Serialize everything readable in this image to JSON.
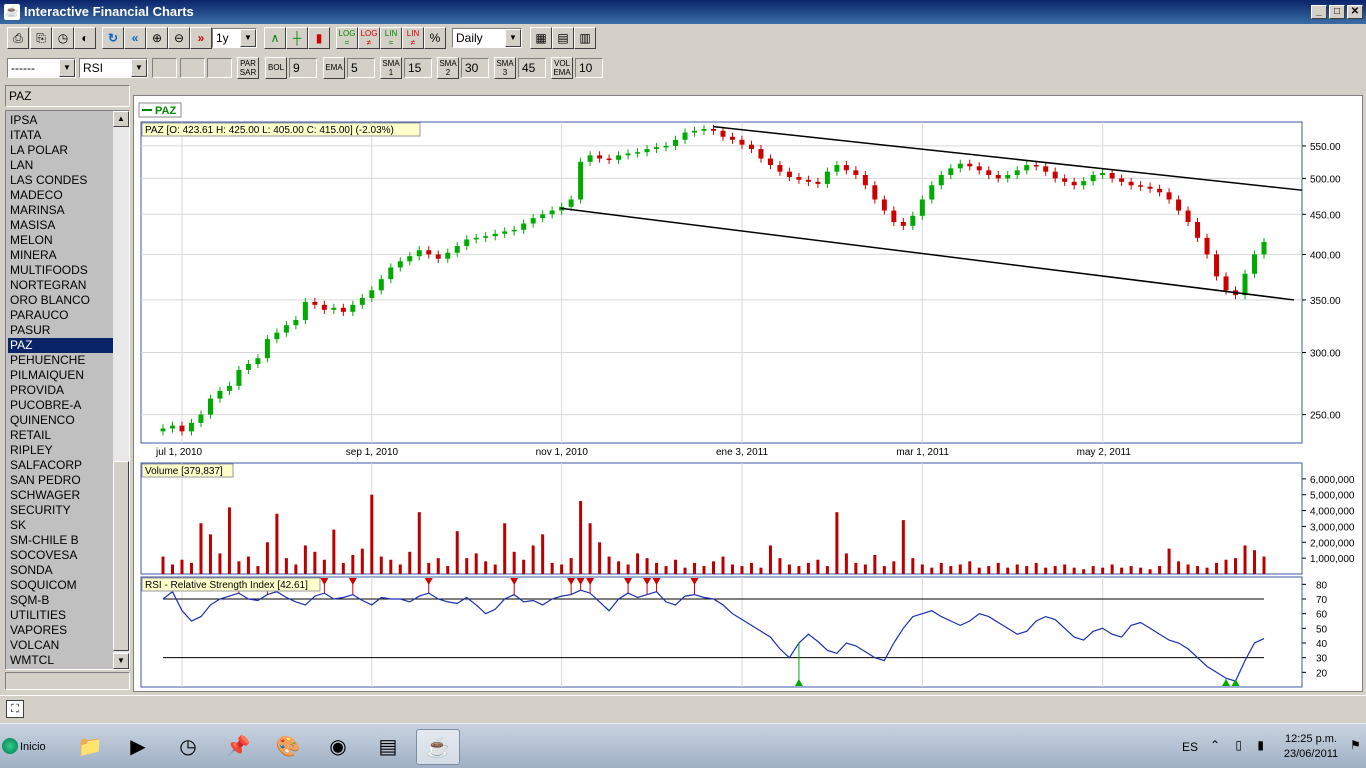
{
  "window": {
    "title": "Interactive Financial Charts",
    "min": "_",
    "max": "□",
    "close": "✕"
  },
  "toolbar": {
    "period": "1y",
    "interval": "Daily",
    "buttons": [
      {
        "label": "⎙",
        "icon": "print-icon"
      },
      {
        "label": "⎘",
        "icon": "print-preview-icon"
      },
      {
        "label": "◷",
        "icon": "clock-icon"
      },
      {
        "label": "◐",
        "icon": "sound-icon"
      },
      {
        "label": "↻",
        "icon": "refresh-icon"
      },
      {
        "label": "«",
        "icon": "rewind-icon"
      },
      {
        "label": "⊕",
        "icon": "zoom-in-icon"
      },
      {
        "label": "⊖",
        "icon": "zoom-out-icon"
      },
      {
        "label": "»",
        "icon": "forward-icon"
      }
    ],
    "chart_buttons": [
      {
        "label": "∧",
        "icon": "line-chart-icon"
      },
      {
        "label": "┼",
        "icon": "bar-chart-icon"
      },
      {
        "label": "▮",
        "icon": "candle-chart-icon"
      }
    ],
    "scale_buttons": [
      "LOG\n=",
      "LOG\n≠",
      "LIN\n=",
      "LIN\n≠",
      "%"
    ],
    "extra_buttons": [
      {
        "label": "▦",
        "icon": "color-scheme-icon"
      },
      {
        "label": "▤",
        "icon": "chart-window-icon"
      },
      {
        "label": "▥",
        "icon": "grid-window-icon"
      }
    ]
  },
  "indicators": {
    "overlay": "------",
    "oscillator": "RSI",
    "items": [
      {
        "btn": "PAR\nSAR",
        "value": ""
      },
      {
        "btn": "BOL",
        "value": "9"
      },
      {
        "btn": "EMA",
        "value": "5"
      },
      {
        "btn": "SMA\n1",
        "value": "15"
      },
      {
        "btn": "SMA\n2",
        "value": "30"
      },
      {
        "btn": "SMA\n3",
        "value": "45"
      },
      {
        "btn": "VOL\nEMA",
        "value": "10"
      }
    ]
  },
  "sidebar": {
    "symbol": "PAZ",
    "selected": "PAZ",
    "symbols": [
      "IPSA",
      "ITATA",
      "LA POLAR",
      "LAN",
      "LAS CONDES",
      "MADECO",
      "MARINSA",
      "MASISA",
      "MELON",
      "MINERA",
      "MULTIFOODS",
      "NORTEGRAN",
      "ORO BLANCO",
      "PARAUCO",
      "PASUR",
      "PAZ",
      "PEHUENCHE",
      "PILMAIQUEN",
      "PROVIDA",
      "PUCOBRE-A",
      "QUINENCO",
      "RETAIL",
      "RIPLEY",
      "SALFACORP",
      "SAN PEDRO",
      "SCHWAGER",
      "SECURITY",
      "SK",
      "SM-CHILE B",
      "SOCOVESA",
      "SONDA",
      "SOQUICOM",
      "SQM-B",
      "UTILITIES",
      "VAPORES",
      "VOLCAN",
      "WMTCL"
    ],
    "scroll_up": "▲",
    "scroll_down": "▼"
  },
  "chart": {
    "legend": "PAZ",
    "price_label": "PAZ [O: 423.61  H: 425.00  L: 405.00  C: 415.00] (-2.03%)",
    "volume_label": "Volume [379,837]",
    "rsi_label": "RSI - Relative Strength Index [42.61]",
    "colors": {
      "up": "#00aa00",
      "down": "#cc0000",
      "rsi": "#1a2fb0",
      "volume": "#bb0000"
    }
  },
  "chart_data": {
    "type": "candlestick",
    "price_axis_ticks": [
      "550.00",
      "500.00",
      "450.00",
      "400.00",
      "350.00",
      "300.00",
      "250.00"
    ],
    "date_axis_ticks": [
      "jul 1, 2010",
      "sep 1, 2010",
      "nov 1, 2010",
      "ene 3, 2011",
      "mar 1, 2011",
      "may 2, 2011"
    ],
    "volume_axis_ticks": [
      "6,000,000",
      "5,000,000",
      "4,000,000",
      "3,000,000",
      "2,000,000",
      "1,000,000"
    ],
    "rsi_axis_ticks": [
      "80",
      "70",
      "60",
      "50",
      "40",
      "30",
      "20"
    ],
    "rsi_levels": [
      70,
      30
    ],
    "y_scale": "log",
    "ylim": [
      230,
      590
    ],
    "closes": [
      240,
      242,
      238,
      244,
      250,
      262,
      268,
      272,
      285,
      290,
      295,
      312,
      318,
      325,
      330,
      348,
      345,
      340,
      342,
      338,
      345,
      352,
      360,
      372,
      385,
      392,
      398,
      405,
      400,
      395,
      402,
      410,
      418,
      420,
      422,
      425,
      428,
      430,
      438,
      445,
      450,
      455,
      460,
      470,
      525,
      535,
      530,
      528,
      535,
      538,
      540,
      545,
      548,
      550,
      560,
      572,
      575,
      578,
      575,
      565,
      560,
      552,
      545,
      530,
      520,
      510,
      502,
      498,
      495,
      492,
      510,
      520,
      512,
      505,
      490,
      470,
      455,
      440,
      435,
      448,
      470,
      490,
      505,
      515,
      522,
      518,
      512,
      505,
      500,
      505,
      512,
      520,
      518,
      510,
      500,
      495,
      490,
      496,
      505,
      508,
      500,
      495,
      490,
      488,
      485,
      480,
      470,
      455,
      440,
      420,
      400,
      375,
      360,
      355,
      378,
      400,
      415
    ],
    "trendlines": [
      {
        "from": [
          "dec 2010",
          458
        ],
        "to": [
          "jun 2011",
          350
        ]
      },
      {
        "from": [
          "ene 2011",
          582
        ],
        "to": [
          "jun 2011",
          483
        ]
      }
    ],
    "rsi": [
      70,
      75,
      62,
      55,
      58,
      66,
      70,
      72,
      74,
      70,
      69,
      73,
      75,
      71,
      68,
      66,
      72,
      74,
      70,
      71,
      73,
      69,
      66,
      71,
      70,
      70,
      68,
      72,
      74,
      70,
      68,
      67,
      71,
      66,
      60,
      63,
      70,
      73,
      68,
      69,
      66,
      70,
      72,
      73,
      76,
      74,
      68,
      62,
      70,
      74,
      71,
      73,
      75,
      68,
      66,
      72,
      73,
      71,
      70,
      66,
      60,
      56,
      52,
      48,
      44,
      36,
      30,
      40,
      46,
      41,
      35,
      33,
      40,
      38,
      34,
      30,
      28,
      40,
      50,
      58,
      60,
      62,
      58,
      55,
      52,
      55,
      60,
      58,
      54,
      50,
      46,
      48,
      55,
      58,
      56,
      50,
      44,
      42,
      48,
      50,
      46,
      44,
      52,
      54,
      50,
      46,
      42,
      40,
      36,
      30,
      24,
      20,
      16,
      14,
      28,
      40,
      43
    ],
    "volumes": [
      1.1,
      0.6,
      0.9,
      0.7,
      3.2,
      2.5,
      1.3,
      4.2,
      0.8,
      1.1,
      0.5,
      2.0,
      3.8,
      1.0,
      0.6,
      1.8,
      1.4,
      0.9,
      2.8,
      0.7,
      1.2,
      1.6,
      5.0,
      1.1,
      0.9,
      0.6,
      1.4,
      3.9,
      0.7,
      1.0,
      0.5,
      2.7,
      1.0,
      1.3,
      0.8,
      0.6,
      3.2,
      1.4,
      0.9,
      1.8,
      2.5,
      0.7,
      0.6,
      1.0,
      4.6,
      3.2,
      2.0,
      1.1,
      0.8,
      0.6,
      1.3,
      1.0,
      0.7,
      0.5,
      0.9,
      0.4,
      0.7,
      0.5,
      0.8,
      1.1,
      0.6,
      0.5,
      0.7,
      0.4,
      1.8,
      1.0,
      0.6,
      0.5,
      0.7,
      0.9,
      0.5,
      3.9,
      1.3,
      0.7,
      0.6,
      1.2,
      0.5,
      0.8,
      3.4,
      1.0,
      0.6,
      0.4,
      0.7,
      0.5,
      0.6,
      0.8,
      0.4,
      0.5,
      0.7,
      0.4,
      0.6,
      0.5,
      0.7,
      0.4,
      0.5,
      0.6,
      0.4,
      0.3,
      0.5,
      0.4,
      0.6,
      0.4,
      0.5,
      0.4,
      0.3,
      0.5,
      1.6,
      0.8,
      0.6,
      0.5,
      0.4,
      0.7,
      0.9,
      1.0,
      1.8,
      1.5,
      1.1
    ]
  },
  "taskbar": {
    "start": "Inicio",
    "lang": "ES",
    "time": "12:25 p.m.",
    "date": "23/06/2011",
    "tray": "⌃ ▯ ▮",
    "tasks": [
      {
        "icon": "folder-icon",
        "glyph": "📁"
      },
      {
        "icon": "media-player-icon",
        "glyph": "▶"
      },
      {
        "icon": "clock-app-icon",
        "glyph": "◷"
      },
      {
        "icon": "pin-icon",
        "glyph": "📌"
      },
      {
        "icon": "paint-icon",
        "glyph": "🎨"
      },
      {
        "icon": "chrome-icon",
        "glyph": "◉"
      },
      {
        "icon": "pdf-icon",
        "glyph": "▤"
      },
      {
        "icon": "java-icon",
        "glyph": "☕"
      }
    ]
  }
}
